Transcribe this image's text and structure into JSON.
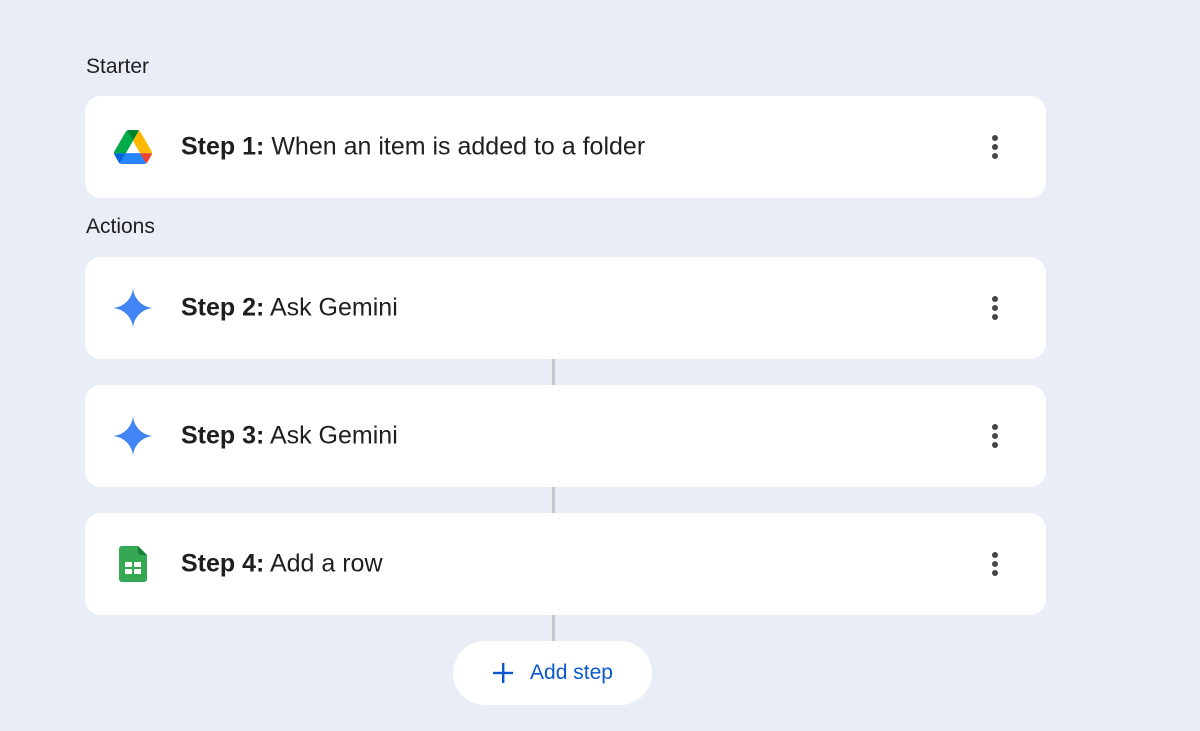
{
  "sections": {
    "starter_label": "Starter",
    "actions_label": "Actions"
  },
  "steps": [
    {
      "number": "Step 1:",
      "text": "When an item is added to a folder",
      "icon": "google-drive-icon"
    },
    {
      "number": "Step 2:",
      "text": "Ask Gemini",
      "icon": "gemini-icon"
    },
    {
      "number": "Step 3:",
      "text": "Ask Gemini",
      "icon": "gemini-icon"
    },
    {
      "number": "Step 4:",
      "text": "Add a row",
      "icon": "google-sheets-icon"
    }
  ],
  "add_step": {
    "label": "Add step",
    "icon": "plus-icon"
  },
  "more_icon": "more-vert-icon",
  "colors": {
    "background": "#e9eef6",
    "card": "#ffffff",
    "accent": "#0b57d0",
    "connector": "#c7c7c7",
    "gemini": "#4285f4",
    "sheets": "#34a853"
  }
}
